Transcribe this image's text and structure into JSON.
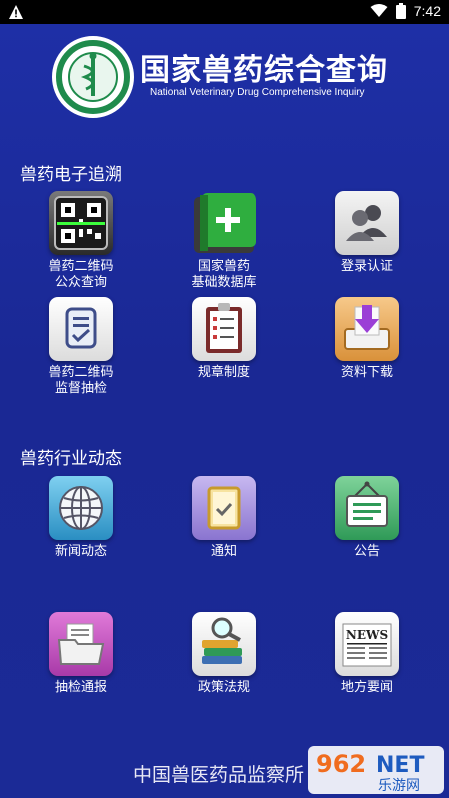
{
  "status_bar": {
    "time": "7:42"
  },
  "header": {
    "title": "国家兽药综合查询",
    "subtitle": "National Veterinary Drug Comprehensive Inquiry"
  },
  "sections": {
    "trace_title": "兽药电子追溯",
    "news_title": "兽药行业动态"
  },
  "tiles": {
    "qr_public": "兽药二维码\n公众查询",
    "basic_db": "国家兽药\n基础数据库",
    "login": "登录认证",
    "qr_supervise": "兽药二维码\n监督抽检",
    "regulations": "规章制度",
    "download": "资料下载",
    "news": "新闻动态",
    "notice": "通知",
    "announcement": "公告",
    "inspection_report": "抽检通报",
    "policy_law": "政策法规",
    "local_news": "地方要闻"
  },
  "footer": {
    "text": "中国兽医药品监察所"
  },
  "watermark": {
    "number": "962",
    "suffix": "NET",
    "name": "乐游网"
  },
  "colors": {
    "background": "#1b2a96",
    "status_bar": "#000000"
  }
}
